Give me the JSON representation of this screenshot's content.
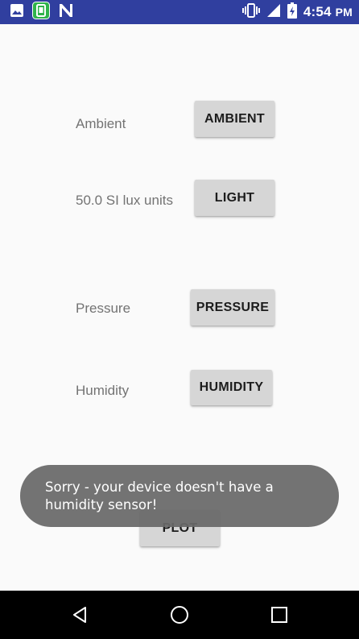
{
  "status_bar": {
    "time": "4:54",
    "ampm": "PM",
    "notification_icons": [
      "image-icon",
      "app-notification-icon",
      "n-logo-icon"
    ],
    "system_icons": [
      "vibrate-icon",
      "signal-icon",
      "battery-charging-icon"
    ]
  },
  "main": {
    "ambient": {
      "label": "Ambient",
      "button": "AMBIENT"
    },
    "light": {
      "label": "50.0 SI lux units",
      "button": "LIGHT"
    },
    "pressure": {
      "label": "Pressure",
      "button": "PRESSURE"
    },
    "humidity": {
      "label": "Humidity",
      "button": "HUMIDITY"
    },
    "plot": {
      "button": "PLOT"
    }
  },
  "toast": {
    "message": "Sorry - your device doesn't have a humidity sensor!"
  },
  "nav_bar": {
    "icons": [
      "back-icon",
      "home-icon",
      "recents-icon"
    ]
  },
  "colors": {
    "status_bar": "#303f9f",
    "background": "#fafafa",
    "button": "#d6d6d6",
    "label_text": "#737373",
    "toast": "#686868",
    "nav_bar": "#000000"
  }
}
